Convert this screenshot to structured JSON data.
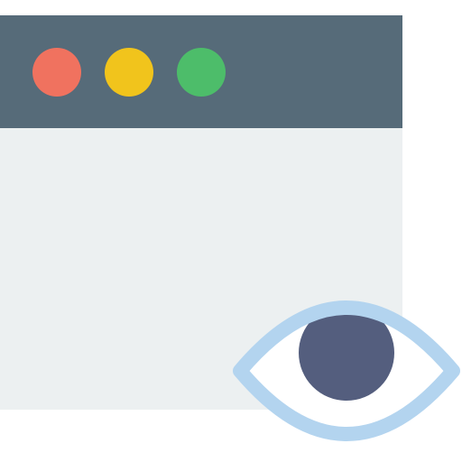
{
  "colors": {
    "titlebar": "#566b79",
    "content": "#ecf0f1",
    "close": "#f0725f",
    "minimize": "#f1c41c",
    "maximize": "#4dbd6a",
    "eye_outline": "#b3d4ef",
    "eye_white": "#ffffff",
    "iris": "#545e7e"
  },
  "icons": {
    "close": "close-dot-icon",
    "minimize": "minimize-dot-icon",
    "maximize": "maximize-dot-icon",
    "eye": "eye-icon"
  }
}
